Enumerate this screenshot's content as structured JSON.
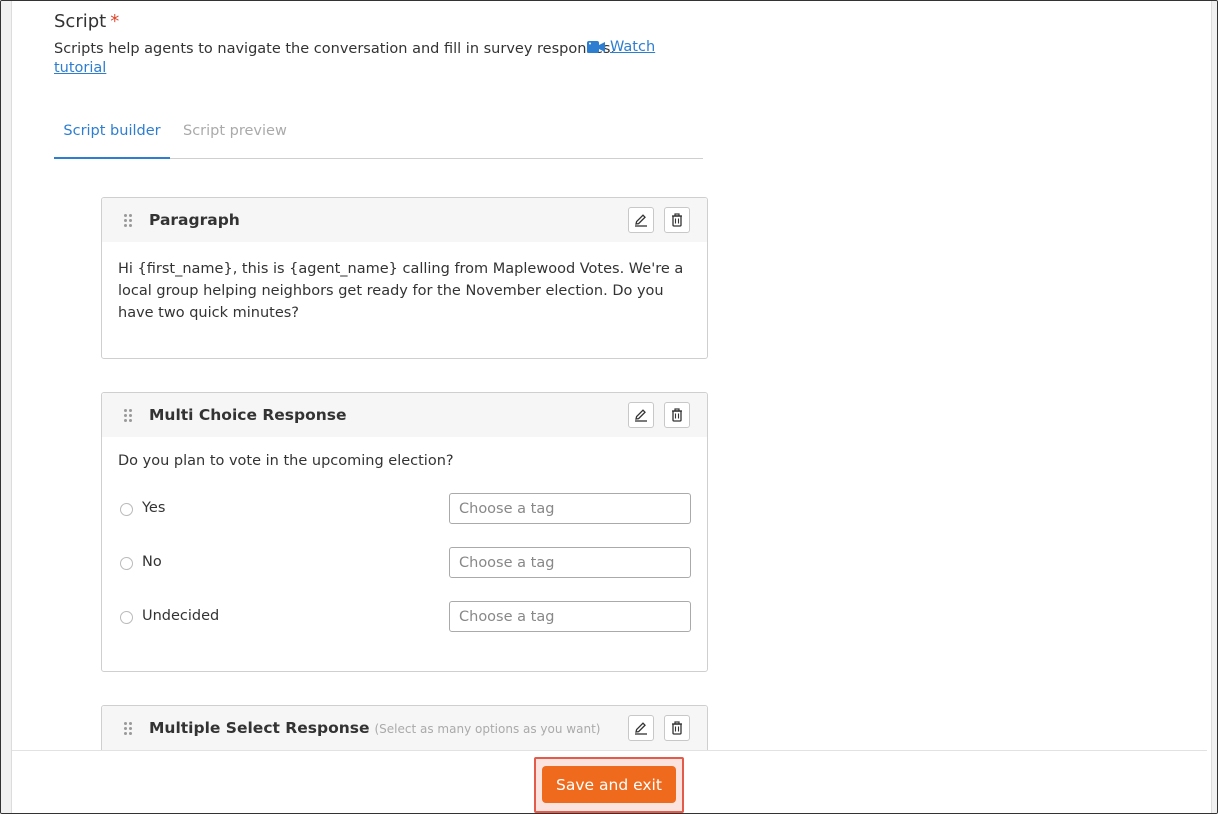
{
  "section": {
    "title": "Script",
    "required_mark": "*",
    "description": "Scripts help agents to navigate the conversation and fill in survey responses.",
    "tutorial_link_line1": "Watch",
    "tutorial_link_line2": "tutorial"
  },
  "tabs": [
    {
      "label": "Script builder",
      "active": true
    },
    {
      "label": "Script preview",
      "active": false
    }
  ],
  "cards": {
    "paragraph": {
      "title": "Paragraph",
      "text": "Hi {first_name}, this is {agent_name} calling from Maplewood Votes. We're a local group helping neighbors get ready for the November election. Do you have two quick minutes?"
    },
    "multi_choice": {
      "title": "Multi Choice Response",
      "question": "Do you plan to vote in the upcoming election?",
      "options": [
        {
          "label": "Yes",
          "tag_placeholder": "Choose a tag"
        },
        {
          "label": "No",
          "tag_placeholder": "Choose a tag"
        },
        {
          "label": "Undecided",
          "tag_placeholder": "Choose a tag"
        }
      ]
    },
    "multi_select": {
      "title": "Multiple Select Response",
      "subtitle": "(Select as many options as you want)"
    }
  },
  "footer": {
    "save_label": "Save and exit"
  },
  "colors": {
    "accent": "#2d7ed1",
    "required": "#e0452b",
    "save_button": "#ef6a1d",
    "highlight_border": "#e35b4a"
  },
  "icons": [
    "video-camera-icon",
    "drag-handle-icon",
    "edit-pencil-icon",
    "trash-icon"
  ]
}
